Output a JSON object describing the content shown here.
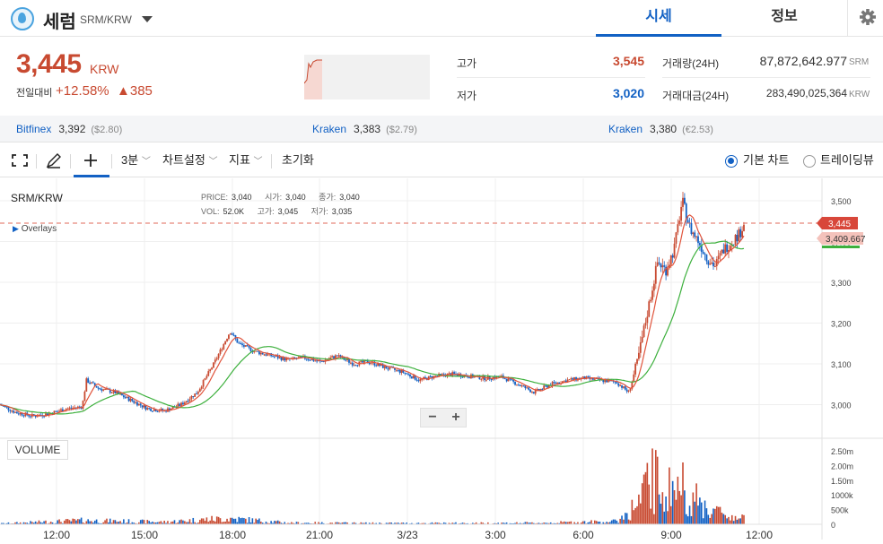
{
  "coin": {
    "name": "세럼",
    "pair": "SRM/KRW"
  },
  "tabs": [
    {
      "label": "시세"
    },
    {
      "label": "정보"
    }
  ],
  "summary": {
    "price": "3,445",
    "unit": "KRW",
    "change_label": "전일대비",
    "change_pct": "+12.58%",
    "change_abs": "▲385",
    "high_label": "고가",
    "high": "3,545",
    "low_label": "저가",
    "low": "3,020",
    "volume_label": "거래량(24H)",
    "volume": "87,872,642.977",
    "volume_unit": "SRM",
    "value_label": "거래대금(24H)",
    "value": "283,490,025,364",
    "value_unit": "KRW"
  },
  "exchanges": [
    {
      "name": "Bitfinex",
      "price": "3,392",
      "usd": "($2.80)"
    },
    {
      "name": "Kraken",
      "price": "3,383",
      "usd": "($2.79)"
    },
    {
      "name": "Kraken",
      "price": "3,380",
      "usd": "(€2.53)"
    }
  ],
  "toolbar": {
    "interval": "3분",
    "chart_settings": "차트설정",
    "indicators": "지표",
    "reset": "초기화",
    "basic_chart": "기본 차트",
    "tradingview": "트레이딩뷰"
  },
  "chart": {
    "symbol": "SRM/KRW",
    "overlays_label": "Overlays",
    "volume_label": "VOLUME",
    "legend": {
      "price_label": "PRICE:",
      "price": "3,040",
      "open_label": "시가:",
      "open": "3,040",
      "close_label": "종가:",
      "close": "3,040",
      "vol_label": "VOL:",
      "vol": "52.0K",
      "high_label": "고가:",
      "high": "3,045",
      "low_label": "저가:",
      "low": "3,035"
    },
    "current_price_tag": "3,445",
    "ma_price_tag": "3,409.667",
    "zoom_out": "−",
    "zoom_in": "+",
    "colors": {
      "up": "#c84a31",
      "down": "#1261c4",
      "ma_fast": "#e0533b",
      "ma_slow": "#3db03d"
    }
  },
  "chart_data": {
    "type": "candlestick",
    "y_ticks": [
      "3,500",
      "3,400",
      "3,300",
      "3,200",
      "3,100",
      "3,000"
    ],
    "y_tick_values": [
      3500,
      3400,
      3300,
      3200,
      3100,
      3000
    ],
    "volume_ticks": [
      "2.50m",
      "2.00m",
      "1.50m",
      "1000k",
      "500k",
      "0"
    ],
    "volume_tick_values": [
      2500000,
      2000000,
      1500000,
      1000000,
      500000,
      0
    ],
    "x_ticks": [
      "12:00",
      "15:00",
      "18:00",
      "21:00",
      "3/23",
      "3:00",
      "6:00",
      "9:00",
      "12:00"
    ],
    "price_path": [
      [
        0,
        3000
      ],
      [
        0.01,
        2990
      ],
      [
        0.02,
        2980
      ],
      [
        0.04,
        2972
      ],
      [
        0.06,
        2978
      ],
      [
        0.08,
        2990
      ],
      [
        0.1,
        2995
      ],
      [
        0.105,
        3060
      ],
      [
        0.12,
        3040
      ],
      [
        0.14,
        3030
      ],
      [
        0.16,
        3010
      ],
      [
        0.18,
        2990
      ],
      [
        0.2,
        2985
      ],
      [
        0.22,
        3000
      ],
      [
        0.24,
        3030
      ],
      [
        0.26,
        3100
      ],
      [
        0.28,
        3180
      ],
      [
        0.29,
        3150
      ],
      [
        0.31,
        3130
      ],
      [
        0.33,
        3120
      ],
      [
        0.35,
        3110
      ],
      [
        0.37,
        3115
      ],
      [
        0.39,
        3105
      ],
      [
        0.41,
        3120
      ],
      [
        0.43,
        3100
      ],
      [
        0.45,
        3105
      ],
      [
        0.47,
        3090
      ],
      [
        0.49,
        3080
      ],
      [
        0.51,
        3060
      ],
      [
        0.53,
        3070
      ],
      [
        0.55,
        3075
      ],
      [
        0.57,
        3070
      ],
      [
        0.59,
        3065
      ],
      [
        0.61,
        3068
      ],
      [
        0.63,
        3050
      ],
      [
        0.65,
        3030
      ],
      [
        0.67,
        3050
      ],
      [
        0.69,
        3060
      ],
      [
        0.71,
        3065
      ],
      [
        0.73,
        3060
      ],
      [
        0.75,
        3055
      ],
      [
        0.765,
        3030
      ],
      [
        0.775,
        3100
      ],
      [
        0.79,
        3250
      ],
      [
        0.8,
        3350
      ],
      [
        0.81,
        3330
      ],
      [
        0.82,
        3380
      ],
      [
        0.83,
        3500
      ],
      [
        0.84,
        3430
      ],
      [
        0.85,
        3400
      ],
      [
        0.86,
        3360
      ],
      [
        0.87,
        3340
      ],
      [
        0.88,
        3380
      ],
      [
        0.89,
        3400
      ],
      [
        0.9,
        3420
      ],
      [
        0.905,
        3445
      ]
    ],
    "volume_profile": [
      [
        0.0,
        40000
      ],
      [
        0.1,
        200000
      ],
      [
        0.2,
        120000
      ],
      [
        0.25,
        250000
      ],
      [
        0.28,
        300000
      ],
      [
        0.35,
        80000
      ],
      [
        0.45,
        60000
      ],
      [
        0.55,
        60000
      ],
      [
        0.65,
        70000
      ],
      [
        0.75,
        150000
      ],
      [
        0.78,
        1200000
      ],
      [
        0.79,
        2500000
      ],
      [
        0.81,
        1800000
      ],
      [
        0.83,
        2000000
      ],
      [
        0.85,
        1100000
      ],
      [
        0.87,
        700000
      ],
      [
        0.89,
        400000
      ],
      [
        0.905,
        300000
      ]
    ]
  }
}
